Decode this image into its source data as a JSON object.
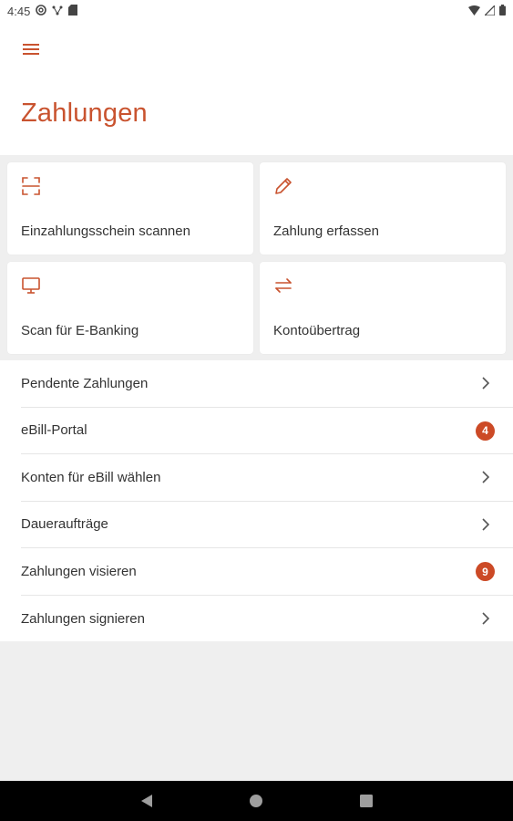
{
  "status_bar": {
    "time": "4:45"
  },
  "app_bar": {
    "title": "Zahlungen"
  },
  "tiles": [
    {
      "label": "Einzahlungsschein scannen",
      "icon": "scan-icon"
    },
    {
      "label": "Zahlung erfassen",
      "icon": "pencil-icon"
    },
    {
      "label": "Scan für E-Banking",
      "icon": "monitor-icon"
    },
    {
      "label": "Kontoübertrag",
      "icon": "transfer-arrows-icon"
    }
  ],
  "list": [
    {
      "label": "Pendente Zahlungen"
    },
    {
      "label": "eBill-Portal",
      "badge": "4"
    },
    {
      "label": "Konten für eBill wählen"
    },
    {
      "label": "Daueraufträge"
    },
    {
      "label": "Zahlungen visieren",
      "badge": "9"
    },
    {
      "label": "Zahlungen signieren"
    }
  ],
  "colors": {
    "accent": "#c9532f",
    "badge": "#cc4a26",
    "background": "#efefef"
  }
}
